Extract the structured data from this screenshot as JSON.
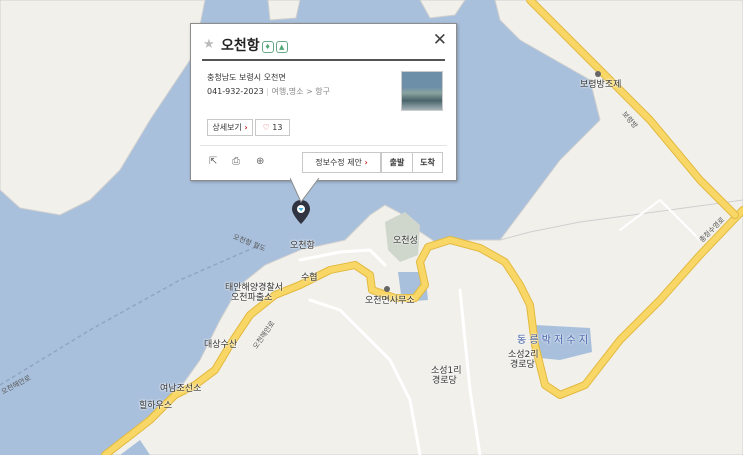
{
  "popup": {
    "title": "오천항",
    "address": "충청남도 보령시 오천면",
    "phone": "041-932-2023",
    "category": "여행,명소 > 항구",
    "detail_label": "상세보기",
    "like_count": "13",
    "suggest_label": "정보수정 제안",
    "depart_label": "출발",
    "arrive_label": "도착",
    "icons": [
      "star-icon",
      "close-icon",
      "share-icon",
      "print-icon",
      "zoom-icon",
      "heart-icon"
    ]
  },
  "map_labels": {
    "pin": "오천항",
    "suhyeop": "수협",
    "coastguard_1": "태안해양경찰서",
    "coastguard_2": "오천파출소",
    "office": "오천면사무소",
    "ocheonseong": "오천성",
    "daesang": "대상수산",
    "yeonam_1": "여남조선소",
    "yeonam_2": "힐하우스",
    "soseong": "소성1리",
    "soseong_hall": "경로당",
    "soseong2": "소성2리",
    "soseong2_hall": "경로당",
    "reservoir": "동 릉 박 저 수 지",
    "boryeong": "보령방조제",
    "road_1": "오천항 월도",
    "road_2": "오천해안로",
    "road_3": "오천해안로",
    "road_4": "충청수영로",
    "road_5": "보령방"
  },
  "colors": {
    "water": "#a9c0dc",
    "land": "#f1f0eb",
    "road": "#f8d766",
    "road_edge": "#e2b93f",
    "park": "#cfd6cc"
  }
}
